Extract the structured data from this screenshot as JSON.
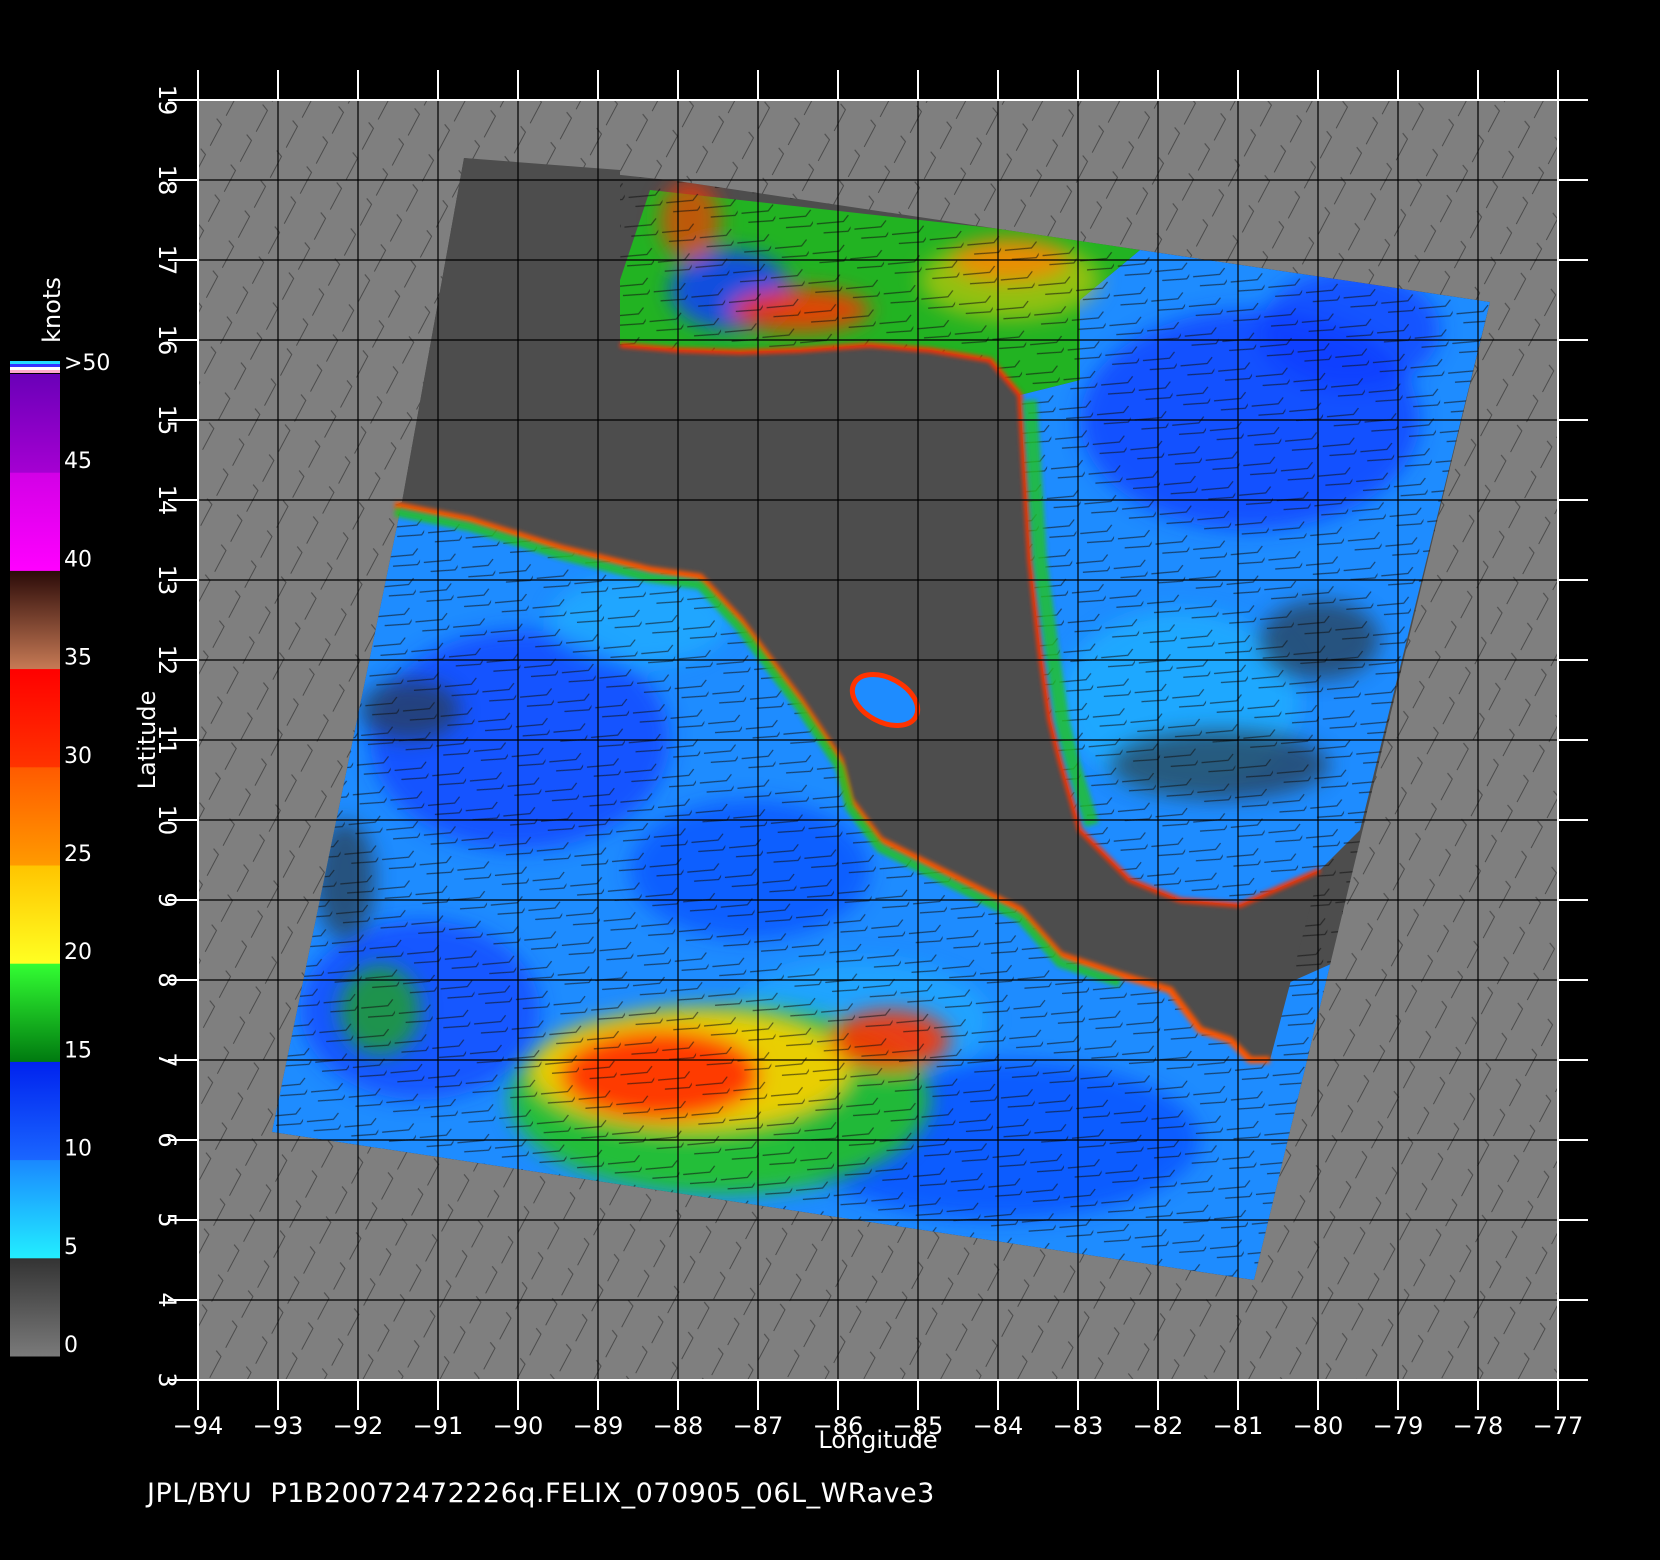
{
  "map": {
    "x_axis": {
      "label": "Longitude",
      "range": [
        -94,
        -77
      ],
      "ticks": [
        "−94",
        "−93",
        "−92",
        "−91",
        "−90",
        "−89",
        "−88",
        "−87",
        "−86",
        "−85",
        "−84",
        "−83",
        "−82",
        "−81",
        "−80",
        "−79",
        "−78",
        "−77"
      ]
    },
    "y_axis": {
      "label": "Latitude",
      "range": [
        3,
        19
      ],
      "ticks": [
        "3",
        "4",
        "5",
        "6",
        "7",
        "8",
        "9",
        "10",
        "11",
        "12",
        "13",
        "14",
        "15",
        "16",
        "17",
        "18",
        "19"
      ]
    },
    "grid": true,
    "legend": {
      "unit": "knots",
      "labels": [
        ">50",
        "45",
        "40",
        "35",
        "30",
        "25",
        "20",
        "15",
        "10",
        "5",
        "0"
      ],
      "bands": [
        {
          "from": 0,
          "to": 5,
          "colors": [
            "#7a7a7a",
            "#333333"
          ]
        },
        {
          "from": 5,
          "to": 10,
          "colors": [
            "#22eeff",
            "#1a88ff"
          ]
        },
        {
          "from": 10,
          "to": 15,
          "colors": [
            "#1a66ff",
            "#0022ee"
          ]
        },
        {
          "from": 15,
          "to": 20,
          "colors": [
            "#007a10",
            "#33ff33"
          ]
        },
        {
          "from": 20,
          "to": 25,
          "colors": [
            "#ffff22",
            "#ffc400"
          ]
        },
        {
          "from": 25,
          "to": 30,
          "colors": [
            "#ff9a00",
            "#ff5a00"
          ]
        },
        {
          "from": 30,
          "to": 35,
          "colors": [
            "#ff3300",
            "#ff0000"
          ]
        },
        {
          "from": 35,
          "to": 40,
          "colors": [
            "#c77a55",
            "#2a0a08"
          ]
        },
        {
          "from": 40,
          "to": 45,
          "colors": [
            "#ff00ff",
            "#d200e6"
          ]
        },
        {
          "from": 45,
          "to": 50,
          "colors": [
            "#a500d2",
            "#6a00b8"
          ]
        }
      ]
    },
    "colors": {
      "background": "#000000",
      "no_data": "#7f7f7f",
      "land": "#4d4d4d",
      "low_wind": "#1e8cff",
      "moderate_wind": "#0a3cff",
      "strong_wind": "#22c322",
      "high_wind": "#ff3300"
    }
  },
  "caption": "JPL/BYU  P1B20072472226q.FELIX_070905_06L_WRave3"
}
